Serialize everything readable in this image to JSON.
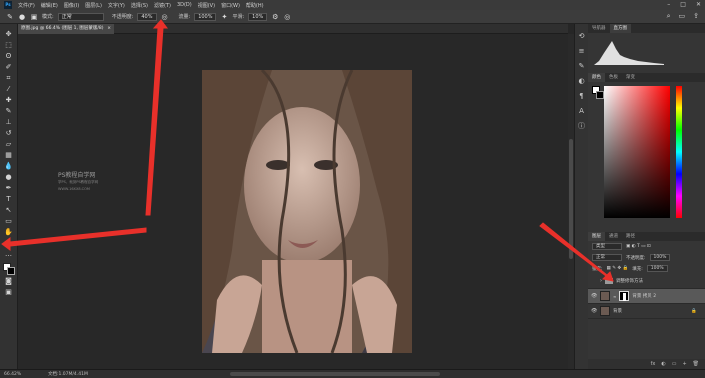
{
  "app": {
    "logo": "Ps",
    "window_controls": [
      "–",
      "□",
      "✕"
    ]
  },
  "menu": [
    "文件(F)",
    "编辑(E)",
    "图像(I)",
    "图层(L)",
    "文字(Y)",
    "选择(S)",
    "滤镜(T)",
    "3D(D)",
    "视图(V)",
    "窗口(W)",
    "帮助(H)"
  ],
  "options": {
    "mode_label": "模式:",
    "mode_value": "正常",
    "opacity_label": "不透明度:",
    "opacity_value": "40%",
    "flow_label": "流量:",
    "flow_value": "100%",
    "smooth_label": "平滑:",
    "smooth_value": "10%"
  },
  "document": {
    "tab_title": "原图.jpg @ 66.4% (图层 1, 图层蒙版/8)",
    "zoom": "66.42%",
    "doc_info": "文档:1.07M/4.41M"
  },
  "watermark": {
    "title": "PS教程自学网",
    "line1": "学PS，就到PS教程自学网",
    "line2": "WWW.16XX8.COM"
  },
  "panels": {
    "top_tabs": [
      "导航器",
      "直方图"
    ],
    "color_tabs": [
      "颜色",
      "色板",
      "渐变"
    ],
    "layer_tabs": [
      "图层",
      "通道",
      "路径"
    ],
    "kind_label": "类型",
    "blend_mode": "正常",
    "opacity_label": "不透明度:",
    "opacity_value": "100%",
    "lock_label": "锁定:",
    "fill_label": "填充:",
    "fill_value": "100%",
    "layers": [
      {
        "name": "调整修饰方法",
        "type": "group"
      },
      {
        "name": "背景 拷贝 2",
        "type": "masked",
        "selected": true
      },
      {
        "name": "背景",
        "type": "background"
      }
    ],
    "footer_icons": [
      "fx",
      "◐",
      "▭",
      "+",
      "🗑"
    ]
  },
  "annotation_colors": {
    "arrow": "#e8302a"
  }
}
